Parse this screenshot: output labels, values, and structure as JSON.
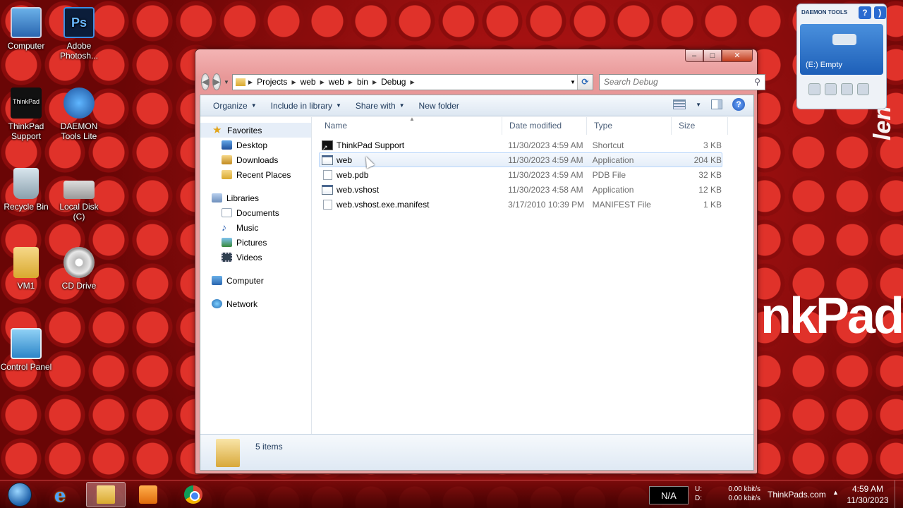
{
  "desktop": {
    "icons": [
      {
        "label": "Computer",
        "icon": "computer-icon"
      },
      {
        "label": "Adobe Photosh...",
        "icon": "photoshop-icon",
        "glyph": "Ps"
      },
      {
        "label": "ThinkPad Support",
        "icon": "thinkpad-icon",
        "glyph": "ThinkPad"
      },
      {
        "label": "DAEMON Tools Lite",
        "icon": "daemon-tools-icon"
      },
      {
        "label": "Recycle Bin",
        "icon": "recycle-bin-icon"
      },
      {
        "label": "Local Disk (C)",
        "icon": "local-disk-icon"
      },
      {
        "label": "VM1",
        "icon": "folder-icon"
      },
      {
        "label": "CD Drive",
        "icon": "cd-drive-icon"
      },
      {
        "label": "Control Panel",
        "icon": "control-panel-icon"
      }
    ],
    "wallpaper_brand_vertical": "len",
    "wallpaper_brand": "nkPad"
  },
  "daemon_gadget": {
    "logo": "DAEMON TOOLS",
    "help_glyph": "?",
    "drive_label": "(E:) Empty"
  },
  "window": {
    "caption": {
      "minimize": "–",
      "maximize": "□",
      "close": "✕"
    },
    "back_glyph": "◀",
    "forward_glyph": "▶",
    "breadcrumb": [
      "Projects",
      "web",
      "web",
      "bin",
      "Debug"
    ],
    "search_placeholder": "Search Debug",
    "toolbar": {
      "organize": "Organize",
      "include_in_library": "Include in library",
      "share_with": "Share with",
      "new_folder": "New folder",
      "help_glyph": "?"
    },
    "nav": {
      "favorites": "Favorites",
      "desktop": "Desktop",
      "downloads": "Downloads",
      "recent_places": "Recent Places",
      "libraries": "Libraries",
      "documents": "Documents",
      "music": "Music",
      "pictures": "Pictures",
      "videos": "Videos",
      "computer": "Computer",
      "network": "Network"
    },
    "columns": {
      "name": "Name",
      "date": "Date modified",
      "type": "Type",
      "size": "Size"
    },
    "files": [
      {
        "name": "ThinkPad Support",
        "date": "11/30/2023 4:59 AM",
        "type": "Shortcut",
        "size": "3 KB",
        "icon": "shortcut-icon"
      },
      {
        "name": "web",
        "date": "11/30/2023 4:59 AM",
        "type": "Application",
        "size": "204 KB",
        "icon": "application-icon"
      },
      {
        "name": "web.pdb",
        "date": "11/30/2023 4:59 AM",
        "type": "PDB File",
        "size": "32 KB",
        "icon": "file-icon"
      },
      {
        "name": "web.vshost",
        "date": "11/30/2023 4:58 AM",
        "type": "Application",
        "size": "12 KB",
        "icon": "application-icon"
      },
      {
        "name": "web.vshost.exe.manifest",
        "date": "3/17/2010 10:39 PM",
        "type": "MANIFEST File",
        "size": "1 KB",
        "icon": "file-icon"
      }
    ],
    "item_count": "5 items"
  },
  "taskbar": {
    "ie_glyph": "e",
    "network_status": "N/A",
    "upload_label": "U:",
    "download_label": "D:",
    "upload_speed": "0.00 kbit/s",
    "download_speed": "0.00 kbit/s",
    "tray_text": "ThinkPads.com",
    "tray_expand": "▲",
    "time": "4:59 AM",
    "date": "11/30/2023"
  }
}
